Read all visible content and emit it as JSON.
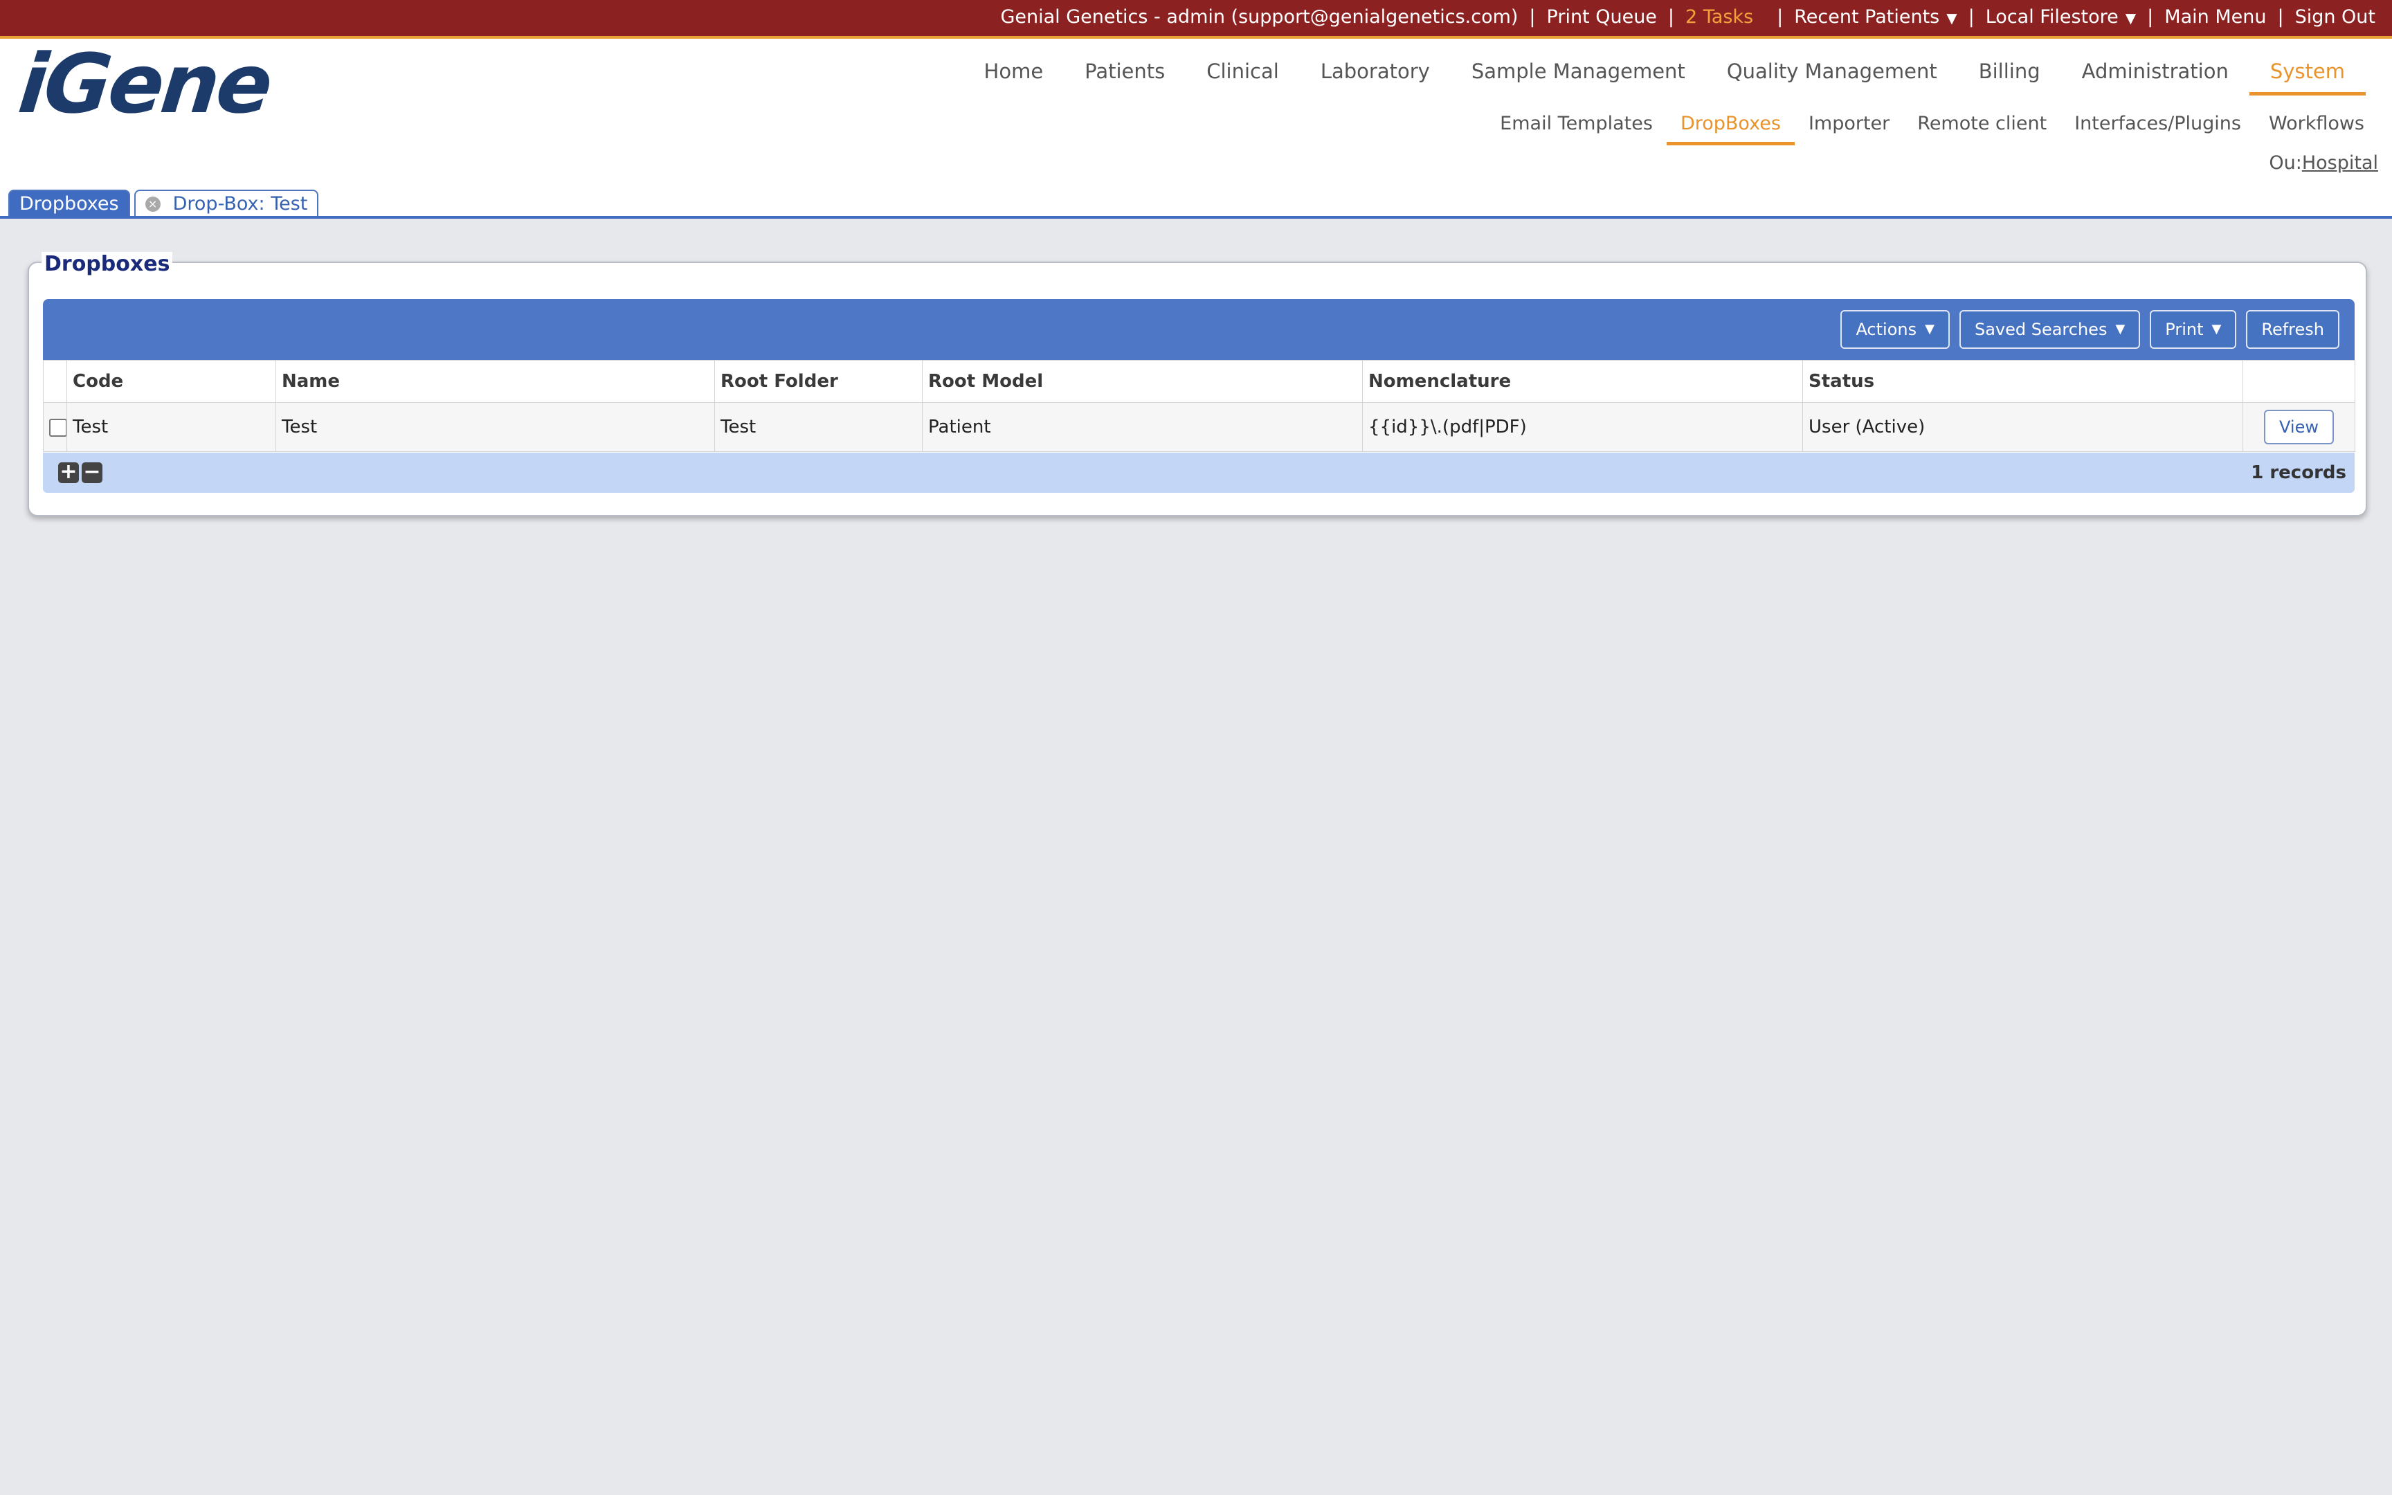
{
  "topbar": {
    "user": "Genial Genetics - admin (support@genialgenetics.com)",
    "print_queue": "Print Queue",
    "tasks": "2 Tasks",
    "recent_patients": "Recent Patients",
    "local_filestore": "Local Filestore",
    "main_menu": "Main Menu",
    "sign_out": "Sign Out",
    "separator": "|",
    "caret": "▼"
  },
  "logo": "iGene",
  "mainnav": [
    "Home",
    "Patients",
    "Clinical",
    "Laboratory",
    "Sample Management",
    "Quality Management",
    "Billing",
    "Administration",
    "System"
  ],
  "subnav": [
    "Email Templates",
    "DropBoxes",
    "Importer",
    "Remote client",
    "Interfaces/Plugins",
    "Workflows"
  ],
  "ou": {
    "label": "Ou:",
    "value": "Hospital"
  },
  "tabs": {
    "active": "Dropboxes",
    "second": "Drop-Box: Test",
    "close_glyph": "×"
  },
  "panel": {
    "title": "Dropboxes",
    "buttons": {
      "actions": "Actions",
      "saved_searches": "Saved Searches",
      "print": "Print",
      "refresh": "Refresh",
      "caret": "▼"
    },
    "columns": [
      "Code",
      "Name",
      "Root Folder",
      "Root Model",
      "Nomenclature",
      "Status"
    ],
    "rows": [
      {
        "code": "Test",
        "name": "Test",
        "root_folder": "Test",
        "root_model": "Patient",
        "nomenclature": "{{id}}\\.(pdf|PDF)",
        "status": "User (Active)",
        "action": "View"
      }
    ],
    "footer": {
      "plus": "+",
      "minus": "−",
      "records": "1 records"
    }
  },
  "colors": {
    "topbar": "#8b2121",
    "accent_orange": "#e8932c",
    "toolbar_blue": "#4e78c6",
    "footer_blue": "#c3d6f5",
    "logo": "#1d3b6a"
  }
}
